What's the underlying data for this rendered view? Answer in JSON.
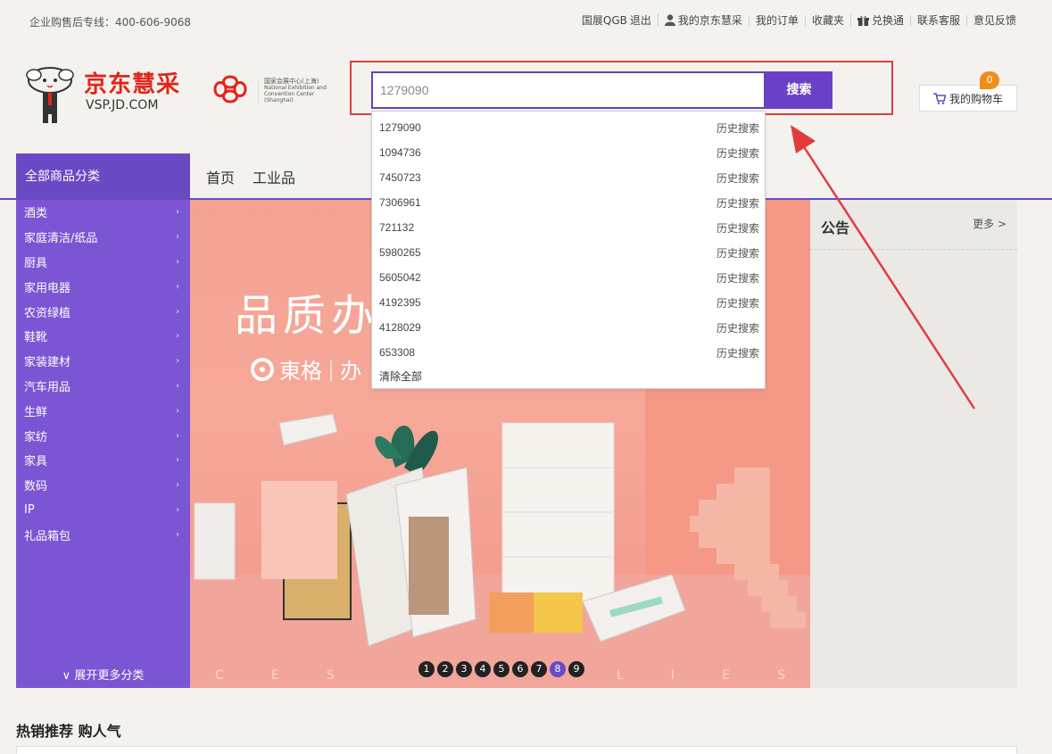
{
  "topbar": {
    "hotline": "企业购售后专线：400-606-9068",
    "links": [
      "国展QGB",
      "退出",
      "我的京东慧采",
      "我的订单",
      "收藏夹",
      "兑换通",
      "联系客服",
      "意见反馈"
    ]
  },
  "header": {
    "brand": "京东慧采",
    "domain": "VSP.JD.COM",
    "expo_cn": "国家会展中心(上海)",
    "expo_en1": "National Exhibition and",
    "expo_en2": "Convention Center (Shanghai)"
  },
  "search": {
    "value": "1279090",
    "button": "搜索"
  },
  "cart": {
    "label": "我的购物车",
    "count": "0"
  },
  "nav": {
    "all_categories": "全部商品分类",
    "items": [
      "首页",
      "工业品"
    ]
  },
  "sidebar": {
    "items": [
      "酒类",
      "家庭清洁/纸品",
      "厨具",
      "家用电器",
      "农资绿植",
      "鞋靴",
      "家装建材",
      "汽车用品",
      "生鲜",
      "家纺",
      "家具",
      "数码",
      "IP",
      "礼品箱包"
    ],
    "more": "展开更多分类"
  },
  "banner": {
    "headline": "品质办",
    "brand": "東格",
    "brand_suffix": "办",
    "letters": [
      "C",
      "E",
      "S",
      "L",
      "I",
      "E",
      "S"
    ],
    "dots": [
      "1",
      "2",
      "3",
      "4",
      "5",
      "6",
      "7",
      "8",
      "9"
    ],
    "active_dot": "8"
  },
  "notice": {
    "title": "公告",
    "more": "更多 >"
  },
  "dropdown": {
    "history": [
      {
        "term": "1279090",
        "tag": "历史搜索"
      },
      {
        "term": "1094736",
        "tag": "历史搜索"
      },
      {
        "term": "7450723",
        "tag": "历史搜索"
      },
      {
        "term": "7306961",
        "tag": "历史搜索"
      },
      {
        "term": "721132",
        "tag": "历史搜索"
      },
      {
        "term": "5980265",
        "tag": "历史搜索"
      },
      {
        "term": "5605042",
        "tag": "历史搜索"
      },
      {
        "term": "4192395",
        "tag": "历史搜索"
      },
      {
        "term": "4128029",
        "tag": "历史搜索"
      },
      {
        "term": "653308",
        "tag": "历史搜索"
      }
    ],
    "clear_all": "清除全部"
  },
  "hot": {
    "title": "热销推荐 购人气"
  },
  "colors": {
    "accent": "#6a4ac4",
    "brand_red": "#e1251b",
    "annotation": "#e23c3c",
    "badge": "#f08c1a"
  }
}
